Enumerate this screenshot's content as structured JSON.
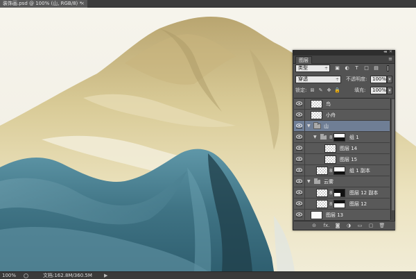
{
  "document": {
    "tab_title": "装饰画.psd @ 100% (山, RGB/8) *",
    "close_glyph": "×"
  },
  "status_bar": {
    "zoom": "100%",
    "doc_size": "文档:162.8M/360.5M",
    "arrow": "▶"
  },
  "layers_panel": {
    "tab_label": "图层",
    "collapse_glyph": "◂◂",
    "close_glyph": "✕",
    "menu_glyph": "≡",
    "filter": {
      "kind_value": "类型",
      "caret": "÷",
      "icons": [
        "image-filter-icon",
        "adjustment-filter-icon",
        "type-filter-icon",
        "shape-filter-icon",
        "smart-object-filter-icon"
      ],
      "icon_glyphs": [
        "▣",
        "◐",
        "T",
        "□",
        "▤"
      ]
    },
    "blend": {
      "mode_value": "穿透",
      "caret": "÷",
      "opacity_label": "不透明度:",
      "opacity_value": "100%",
      "arrow": "▾"
    },
    "lock": {
      "label": "锁定:",
      "icon_glyphs": [
        "⊠",
        "✎",
        "✥",
        "🔒"
      ],
      "fill_label": "填充:",
      "fill_value": "100%",
      "arrow": "▾"
    },
    "layers": [
      {
        "name": "鸟",
        "kind": "layer",
        "indent": 0
      },
      {
        "name": "小舟",
        "kind": "layer",
        "indent": 0
      },
      {
        "name": "山",
        "kind": "group",
        "indent": 0,
        "expanded": true,
        "selected": true
      },
      {
        "name": "组 1",
        "kind": "group-masked",
        "indent": 1,
        "expanded": true
      },
      {
        "name": "图层 14",
        "kind": "layer",
        "indent": 2
      },
      {
        "name": "图层 15",
        "kind": "layer",
        "indent": 2
      },
      {
        "name": "组 1 副本",
        "kind": "layer-masked",
        "indent": 1
      },
      {
        "name": "云雾",
        "kind": "group",
        "indent": 0,
        "expanded": true
      },
      {
        "name": "图层 12 副本",
        "kind": "layer-masked",
        "indent": 1
      },
      {
        "name": "图层 12",
        "kind": "layer-masked",
        "indent": 1
      },
      {
        "name": "图层 13",
        "kind": "layer-white",
        "indent": 1
      }
    ],
    "footer_icons": [
      "link-icon",
      "fx-icon",
      "mask-icon",
      "adjustment-icon",
      "folder-icon",
      "new-layer-icon",
      "trash-icon"
    ],
    "footer_glyphs": [
      "⊝",
      "fx.",
      "◙",
      "◑",
      "▭",
      "▢",
      "🗑"
    ],
    "glyphs": {
      "tri_down": "▼",
      "chain": "8"
    }
  },
  "colors": {
    "panel_bg": "#535353",
    "selected_row": "#6f7e95",
    "mountain_teal": "#3f7384",
    "mountain_ochre": "#c9b98a"
  }
}
